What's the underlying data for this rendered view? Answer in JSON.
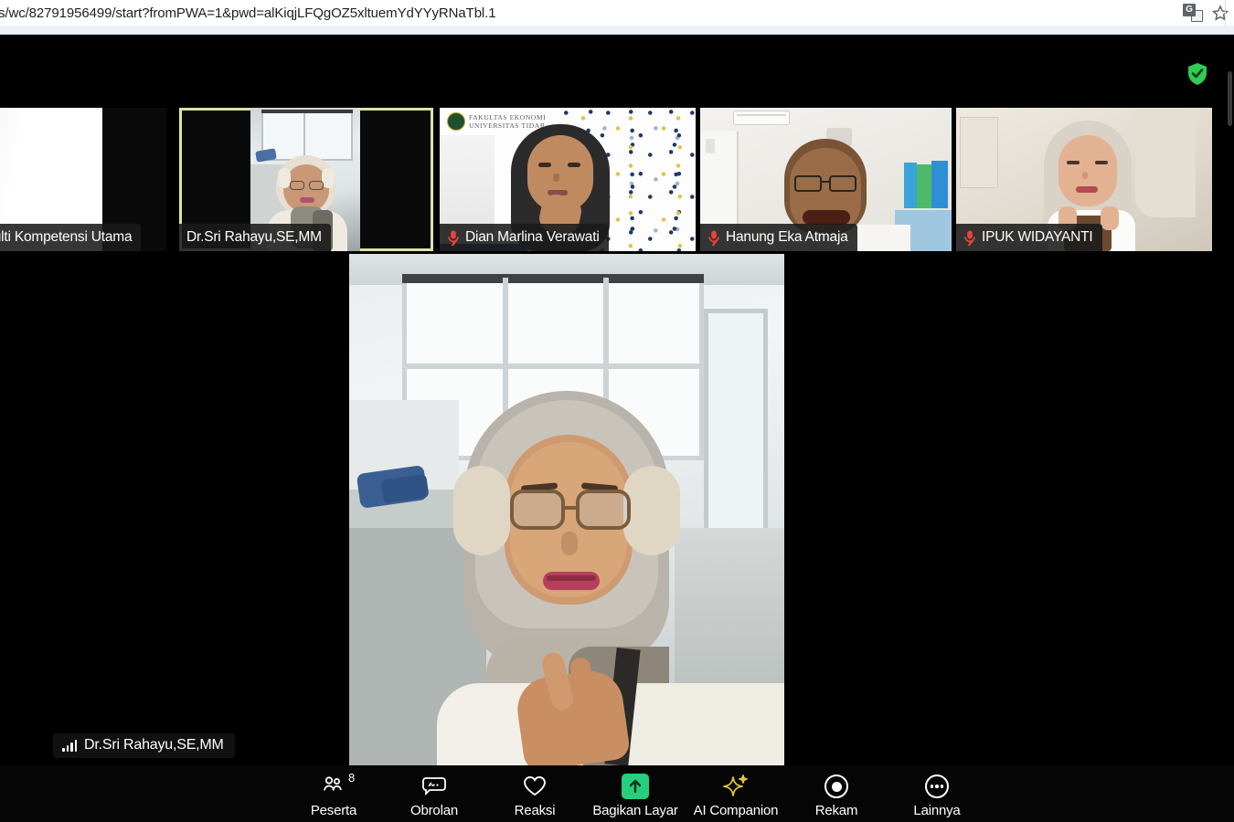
{
  "browser": {
    "url": "s/wc/82791956499/start?fromPWA=1&pwd=alKiqjLFQgOZ5xltuemYdYYyRNaTbl.1",
    "translate_icon": "translate-icon",
    "bookmark_icon": "star-icon"
  },
  "meeting": {
    "encryption_icon": "shield-check-icon",
    "accent_active_speaker": "#dee2a4",
    "share_button_color": "#25d07d",
    "ai_companion_color": "#e8c33a",
    "mute_icon_color": "#e8453c",
    "main_speaker": {
      "name": "Dr.Sri Rahayu,SE,MM",
      "audio_icon": "audio-level-bars-icon"
    },
    "thumbnails": [
      {
        "name": "Multi Kompetensi Utama",
        "muted": false,
        "active": false,
        "mic_icon": ""
      },
      {
        "name": "Dr.Sri Rahayu,SE,MM",
        "muted": false,
        "active": true,
        "mic_icon": ""
      },
      {
        "name": "Dian Marlina Verawati",
        "muted": true,
        "active": false,
        "mic_icon": "mic-muted-icon"
      },
      {
        "name": "Hanung Eka Atmaja",
        "muted": true,
        "active": false,
        "mic_icon": "mic-muted-icon"
      },
      {
        "name": "IPUK WIDAYANTI",
        "muted": true,
        "active": false,
        "mic_icon": "mic-muted-icon"
      }
    ],
    "virtual_bg_text": {
      "line1": "FAKULTAS EKONOMI",
      "line2": "UNIVERSITAS TIDAR"
    }
  },
  "toolbar": {
    "participants": {
      "label": "Peserta",
      "count": "8",
      "icon": "people-icon"
    },
    "chat": {
      "label": "Obrolan",
      "icon": "chat-bubble-icon",
      "chevron": "chevron-up-icon"
    },
    "reactions": {
      "label": "Reaksi",
      "icon": "heart-icon"
    },
    "share": {
      "label": "Bagikan Layar",
      "icon": "share-screen-arrow-up-icon"
    },
    "ai": {
      "label": "AI Companion",
      "icon": "sparkle-icon"
    },
    "record": {
      "label": "Rekam",
      "icon": "record-circle-icon"
    },
    "more": {
      "label": "Lainnya",
      "icon": "ellipsis-circle-icon"
    }
  }
}
